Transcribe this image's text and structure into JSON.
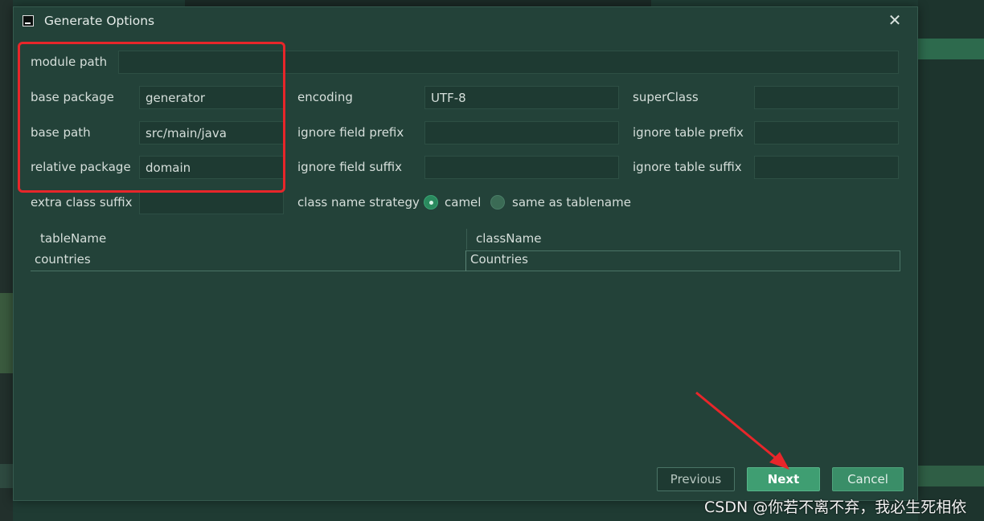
{
  "window": {
    "title": "Generate Options",
    "close_symbol": "✕"
  },
  "form": {
    "module_path": {
      "label": "module path",
      "value": ""
    },
    "base_package": {
      "label": "base package",
      "value": "generator"
    },
    "base_path": {
      "label": "base path",
      "value": "src/main/java"
    },
    "relative_package": {
      "label": "relative package",
      "value": "domain"
    },
    "extra_class_suffix": {
      "label": "extra class suffix",
      "value": ""
    },
    "encoding": {
      "label": "encoding",
      "value": "UTF-8"
    },
    "ignore_field_prefix": {
      "label": "ignore field prefix",
      "value": ""
    },
    "ignore_field_suffix": {
      "label": "ignore field suffix",
      "value": ""
    },
    "super_class": {
      "label": "superClass",
      "value": ""
    },
    "ignore_table_prefix": {
      "label": "ignore table prefix",
      "value": ""
    },
    "ignore_table_suffix": {
      "label": "ignore table suffix",
      "value": ""
    },
    "class_name_strategy": {
      "label": "class name strategy",
      "options": [
        "camel",
        "same as tablename"
      ],
      "selected": "camel"
    }
  },
  "table": {
    "columns": [
      "tableName",
      "className"
    ],
    "rows": [
      [
        "countries",
        "Countries"
      ]
    ]
  },
  "buttons": {
    "previous": "Previous",
    "next": "Next",
    "cancel": "Cancel"
  },
  "colors": {
    "dialog_bg": "#234239",
    "accent_green": "#3f9e72",
    "annotation_red": "#e8262a"
  },
  "watermark": "CSDN @你若不离不弃，我必生死相依"
}
